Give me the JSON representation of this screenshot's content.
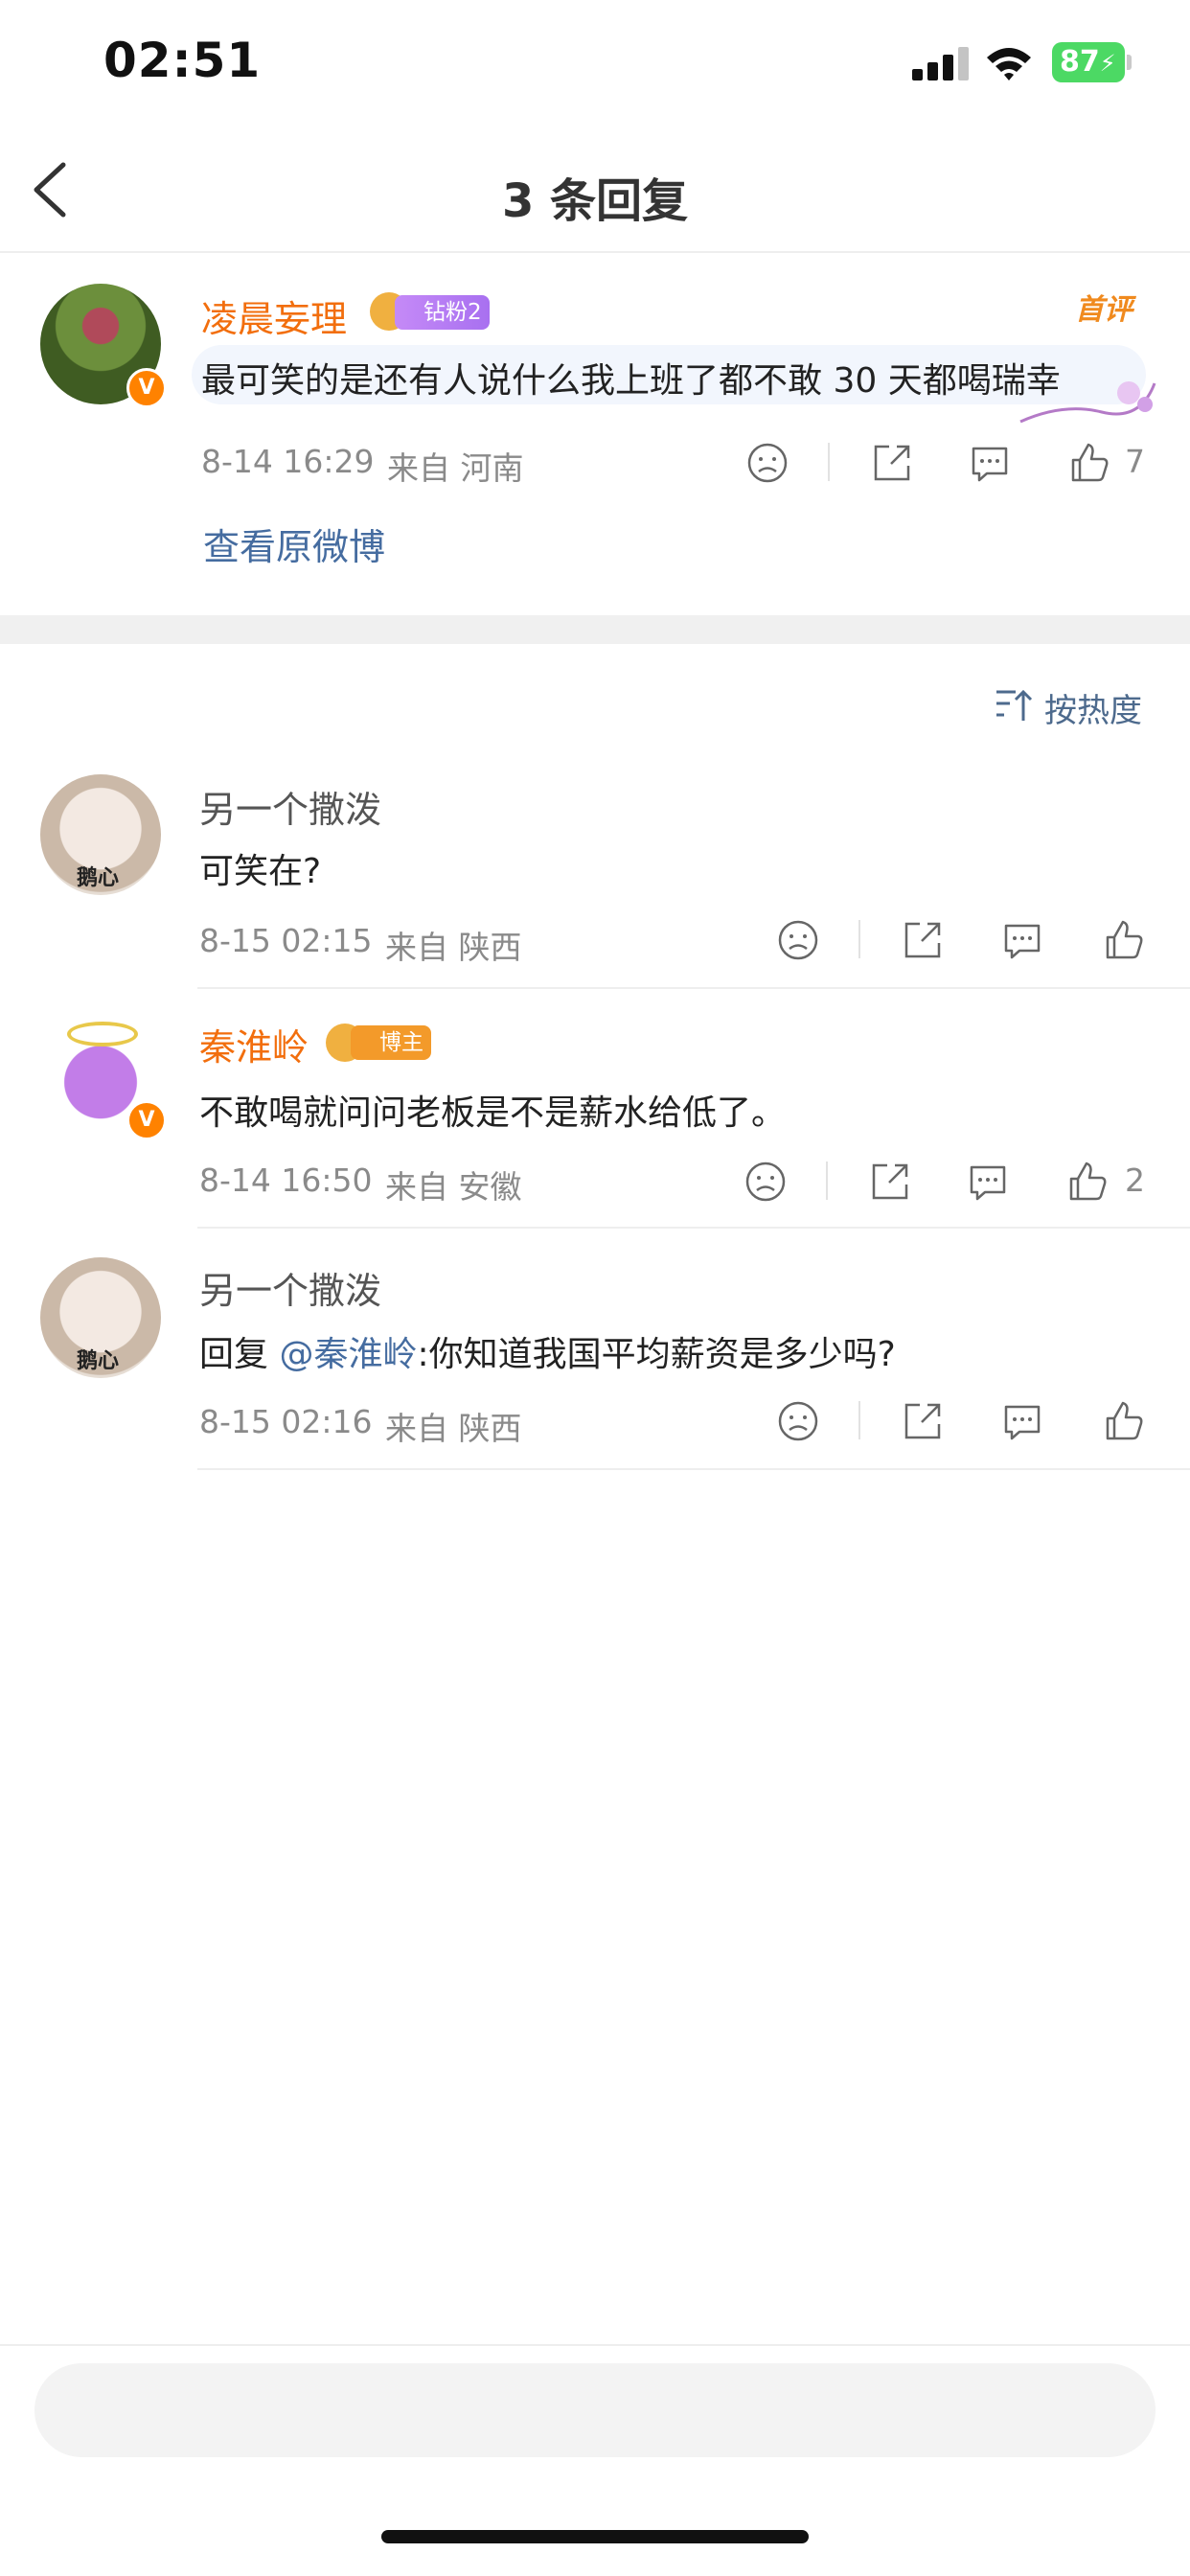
{
  "status_bar": {
    "time": "02:51",
    "battery": "87"
  },
  "header": {
    "title": "3 条回复"
  },
  "root_comment": {
    "username": "凌晨妄理",
    "badge": "钻粉2",
    "tag": "首评",
    "text": "最可笑的是还有人说什么我上班了都不敢 30 天都喝瑞幸",
    "time": "8-14 16:29",
    "source": "来自 河南",
    "likes": "7",
    "view_original": "查看原微博"
  },
  "sort_label": "按热度",
  "replies": [
    {
      "username": "另一个撒泼",
      "avatar_label": "鹅心",
      "text": "可笑在?",
      "time": "8-15 02:15",
      "source": "来自 陕西",
      "likes": ""
    },
    {
      "username": "秦淮岭",
      "badge": "博主",
      "text": "不敢喝就问问老板是不是薪水给低了。",
      "time": "8-14 16:50",
      "source": "来自 安徽",
      "likes": "2"
    },
    {
      "username": "另一个撒泼",
      "avatar_label": "鹅心",
      "reply_prefix": "回复 ",
      "mention": "@秦淮岭",
      "text": ":你知道我国平均薪资是多少吗?",
      "time": "8-15 02:16",
      "source": "来自 陕西",
      "likes": ""
    }
  ],
  "colors": {
    "orange": "#f26e0d",
    "link": "#456ca0",
    "meta": "#8a8a8a"
  }
}
